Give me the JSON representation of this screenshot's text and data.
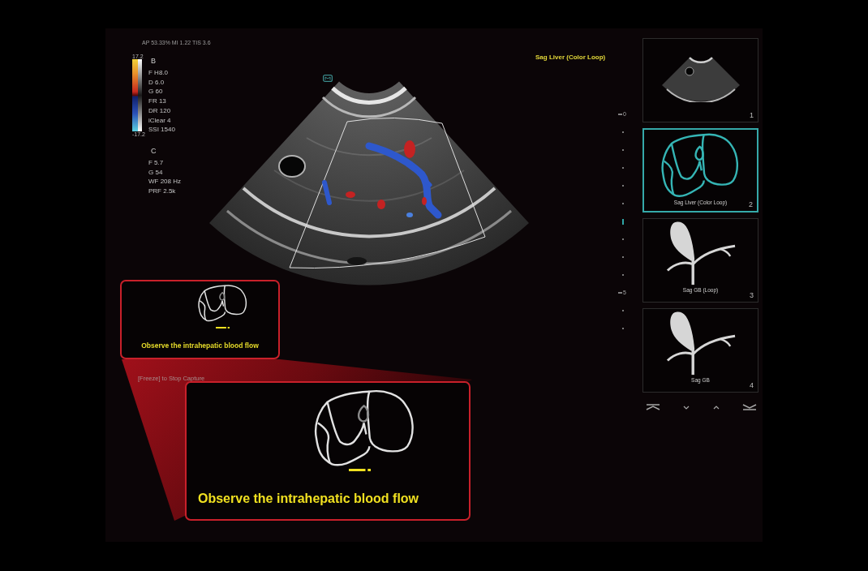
{
  "scan_info": {
    "header": "AP 53.33% MI 1.22 TIS 3.6",
    "b_mode": {
      "label": "B",
      "scale_max": "17.2",
      "scale_min": "-17.2",
      "params": [
        "F H8.0",
        "D 6.0",
        "G 60",
        "FR 13",
        "DR 120",
        "iClear 4",
        "SSI 1540"
      ]
    },
    "color_mode": {
      "label": "C",
      "params": [
        "F 5.7",
        "G 54",
        "WF 208 Hz",
        "PRF 2.5k"
      ]
    }
  },
  "image_title": "Sag Liver (Color Loop)",
  "depth_scale": {
    "labels": [
      "0",
      "5"
    ]
  },
  "hint": "[Freeze] to Stop Capture",
  "callout": {
    "caption": "Observe the intrahepatic blood flow"
  },
  "zoomed_callout": {
    "caption": "Observe the intrahepatic blood flow"
  },
  "thumbnails": [
    {
      "kind": "scan",
      "number": "1",
      "selected": false
    },
    {
      "kind": "liver",
      "label": "Sag Liver (Color Loop)",
      "number": "2",
      "selected": true
    },
    {
      "kind": "gallbladder",
      "label": "Sag GB (Loop)",
      "number": "3",
      "selected": false
    },
    {
      "kind": "gallbladder",
      "label": "Sag GB",
      "number": "4",
      "selected": false
    }
  ],
  "navigation": [
    {
      "kind": "top"
    },
    {
      "kind": "down"
    },
    {
      "kind": "up"
    },
    {
      "kind": "bottom"
    }
  ]
}
